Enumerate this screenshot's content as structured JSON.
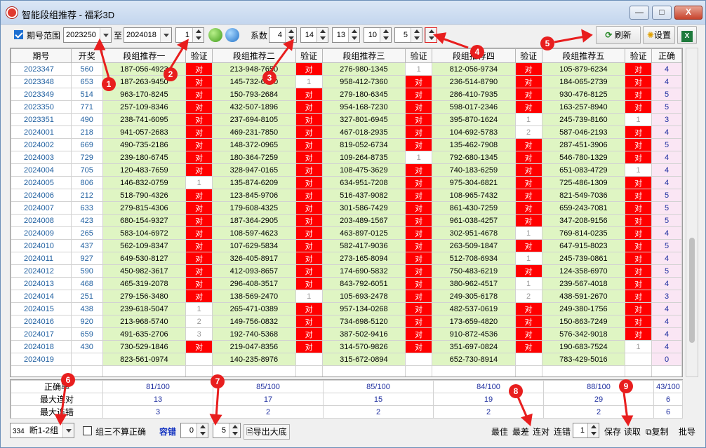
{
  "window": {
    "title": "智能段组推荐 - 福彩3D",
    "min": "—",
    "max": "□",
    "close": "X"
  },
  "toolbar": {
    "range_label": "期号范围",
    "from": "2023250",
    "to_label": "至",
    "to": "2024018",
    "step": "1",
    "coef_label": "系数",
    "coef": [
      "4",
      "14",
      "13",
      "10",
      "5"
    ],
    "refresh": "刷新",
    "settings": "设置",
    "excel": "X"
  },
  "columns": [
    "期号",
    "开奖",
    "段组推荐一",
    "验证",
    "段组推荐二",
    "验证",
    "段组推荐三",
    "验证",
    "段组推荐四",
    "验证",
    "段组推荐五",
    "验证",
    "正确"
  ],
  "rows": [
    [
      "2023347",
      "560",
      "187-056-4923",
      "对",
      "213-948-7650",
      "对",
      "276-980-1345",
      "1",
      "812-056-9734",
      "对",
      "105-879-6234",
      "对",
      "4"
    ],
    [
      "2023348",
      "653",
      "187-263-9450",
      "对",
      "145-732-6890",
      "1",
      "958-412-7360",
      "对",
      "236-514-8790",
      "对",
      "184-065-2739",
      "对",
      "4"
    ],
    [
      "2023349",
      "514",
      "963-170-8245",
      "对",
      "150-793-2684",
      "对",
      "279-180-6345",
      "对",
      "286-410-7935",
      "对",
      "930-476-8125",
      "对",
      "5"
    ],
    [
      "2023350",
      "771",
      "257-109-8346",
      "对",
      "432-507-1896",
      "对",
      "954-168-7230",
      "对",
      "598-017-2346",
      "对",
      "163-257-8940",
      "对",
      "5"
    ],
    [
      "2023351",
      "490",
      "238-741-6095",
      "对",
      "237-694-8105",
      "对",
      "327-801-6945",
      "对",
      "395-870-1624",
      "1",
      "245-739-8160",
      "1",
      "3"
    ],
    [
      "2024001",
      "218",
      "941-057-2683",
      "对",
      "469-231-7850",
      "对",
      "467-018-2935",
      "对",
      "104-692-5783",
      "2",
      "587-046-2193",
      "对",
      "4"
    ],
    [
      "2024002",
      "669",
      "490-735-2186",
      "对",
      "148-372-0965",
      "对",
      "819-052-6734",
      "对",
      "135-462-7908",
      "对",
      "287-451-3906",
      "对",
      "5"
    ],
    [
      "2024003",
      "729",
      "239-180-6745",
      "对",
      "180-364-7259",
      "对",
      "109-264-8735",
      "1",
      "792-680-1345",
      "对",
      "546-780-1329",
      "对",
      "4"
    ],
    [
      "2024004",
      "705",
      "120-483-7659",
      "对",
      "328-947-0165",
      "对",
      "108-475-3629",
      "对",
      "740-183-6259",
      "对",
      "651-083-4729",
      "1",
      "4"
    ],
    [
      "2024005",
      "806",
      "146-832-0759",
      "1",
      "135-874-6209",
      "对",
      "634-951-7208",
      "对",
      "975-304-6821",
      "对",
      "725-486-1309",
      "对",
      "4"
    ],
    [
      "2024006",
      "212",
      "518-790-4326",
      "对",
      "123-845-9706",
      "对",
      "516-437-9082",
      "对",
      "108-965-7432",
      "对",
      "821-549-7036",
      "对",
      "5"
    ],
    [
      "2024007",
      "633",
      "279-815-4306",
      "对",
      "179-608-4325",
      "对",
      "301-586-7429",
      "对",
      "861-430-7259",
      "对",
      "659-243-7081",
      "对",
      "5"
    ],
    [
      "2024008",
      "423",
      "680-154-9327",
      "对",
      "187-364-2905",
      "对",
      "203-489-1567",
      "对",
      "961-038-4257",
      "对",
      "347-208-9156",
      "对",
      "5"
    ],
    [
      "2024009",
      "265",
      "583-104-6972",
      "对",
      "108-597-4623",
      "对",
      "463-897-0125",
      "对",
      "302-951-4678",
      "1",
      "769-814-0235",
      "对",
      "4"
    ],
    [
      "2024010",
      "437",
      "562-109-8347",
      "对",
      "107-629-5834",
      "对",
      "582-417-9036",
      "对",
      "263-509-1847",
      "对",
      "647-915-8023",
      "对",
      "5"
    ],
    [
      "2024011",
      "927",
      "649-530-8127",
      "对",
      "326-405-8917",
      "对",
      "273-165-8094",
      "对",
      "512-708-6934",
      "1",
      "245-739-0861",
      "对",
      "4"
    ],
    [
      "2024012",
      "590",
      "450-982-3617",
      "对",
      "412-093-8657",
      "对",
      "174-690-5832",
      "对",
      "750-483-6219",
      "对",
      "124-358-6970",
      "对",
      "5"
    ],
    [
      "2024013",
      "468",
      "465-319-2078",
      "对",
      "296-408-3517",
      "对",
      "843-792-6051",
      "对",
      "380-962-4517",
      "1",
      "239-567-4018",
      "对",
      "4"
    ],
    [
      "2024014",
      "251",
      "279-156-3480",
      "对",
      "138-569-2470",
      "1",
      "105-693-2478",
      "对",
      "249-305-6178",
      "2",
      "438-591-2670",
      "对",
      "3"
    ],
    [
      "2024015",
      "438",
      "239-618-5047",
      "1",
      "265-471-0389",
      "对",
      "957-134-0268",
      "对",
      "482-537-0619",
      "对",
      "249-380-1756",
      "对",
      "4"
    ],
    [
      "2024016",
      "920",
      "213-968-5740",
      "2",
      "149-756-0832",
      "对",
      "734-698-5120",
      "对",
      "173-659-4820",
      "对",
      "150-863-7249",
      "对",
      "4"
    ],
    [
      "2024017",
      "659",
      "491-635-2706",
      "3",
      "192-740-5368",
      "对",
      "387-502-9416",
      "对",
      "910-872-4536",
      "对",
      "576-342-9018",
      "对",
      "4"
    ],
    [
      "2024018",
      "430",
      "730-529-1846",
      "对",
      "219-047-8356",
      "对",
      "314-570-9826",
      "对",
      "351-697-0824",
      "对",
      "190-683-7524",
      "1",
      "4"
    ],
    [
      "2024019",
      "",
      "823-561-0974",
      "",
      "140-235-8976",
      "",
      "315-672-0894",
      "",
      "652-730-8914",
      "",
      "783-429-5016",
      "",
      "0"
    ]
  ],
  "stats": [
    {
      "label": "正确率",
      "values": [
        "81/100",
        "85/100",
        "85/100",
        "84/100",
        "88/100",
        "43/100"
      ]
    },
    {
      "label": "最大连对",
      "values": [
        "13",
        "17",
        "15",
        "19",
        "29",
        "6"
      ]
    },
    {
      "label": "最大连错",
      "values": [
        "3",
        "2",
        "2",
        "2",
        "2",
        "6"
      ]
    }
  ],
  "bottom": {
    "count": "334",
    "mode": "断1-2组",
    "z3_label": "组三不算正确",
    "tol_label": "容错",
    "tol": "0",
    "tol2": "5",
    "export": "导出大底",
    "best": "最佳",
    "worst": "最差",
    "lian_dui": "连对",
    "lian_cuo": "连错",
    "n": "1",
    "save": "保存",
    "read": "读取",
    "copy": "复制",
    "batch": "批导"
  },
  "annotations": [
    "1",
    "2",
    "3",
    "4",
    "5",
    "6",
    "7",
    "8",
    "9"
  ]
}
